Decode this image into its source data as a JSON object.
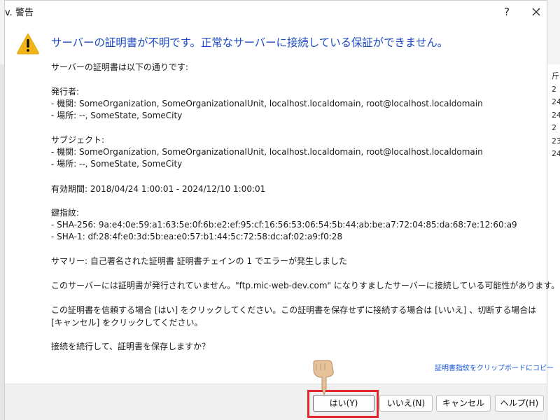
{
  "window": {
    "title": "v. 警告",
    "help_glyph": "?"
  },
  "background": {
    "right_edge_chars": "斤\n2\n24\n24\n2\n23\n24"
  },
  "dialog": {
    "headline": "サーバーの証明書が不明です。正常なサーバーに接続している保証ができません。",
    "lines": {
      "intro": "サーバーの証明書は以下の通りです:",
      "issuer_heading": "発行者:",
      "issuer_org": "- 機関: SomeOrganization, SomeOrganizationalUnit, localhost.localdomain, root@localhost.localdomain",
      "issuer_loc": "- 場所: --, SomeState, SomeCity",
      "subject_heading": "サブジェクト:",
      "subject_org": "- 機関: SomeOrganization, SomeOrganizationalUnit, localhost.localdomain, root@localhost.localdomain",
      "subject_loc": "- 場所: --, SomeState, SomeCity",
      "validity": "有効期間: 2018/04/24 1:00:01 - 2024/12/10 1:00:01",
      "fingerprint_heading": "鍵指紋:",
      "sha256": "- SHA-256: 9a:e4:0e:59:a1:63:5e:0f:6b:e2:ef:95:cf:16:56:53:06:54:5b:44:ab:be:a7:72:04:85:da:68:7e:12:60:a9",
      "sha1": "- SHA-1: df:28:4f:e0:3d:5b:ea:e0:57:b1:44:5c:72:58:dc:af:02:a9:f0:28",
      "summary": "サマリー: 自己署名された証明書 証明書チェインの 1 でエラーが発生しました",
      "warning": "このサーバーには証明書が発行されていません。\"ftp.mic-web-dev.com\" になりすましたサーバーに接続している可能性があります。",
      "instruction": "この証明書を信頼する場合 [はい] をクリックしてください。この証明書を保存せずに接続する場合は [いいえ] 、切断する場合は [キャンセル] をクリックしてください。",
      "question": "接続を続行して、証明書を保存しますか？"
    },
    "copy_link": "証明書指紋をクリップボードにコピー"
  },
  "buttons": {
    "yes": "はい(Y)",
    "no": "いいえ(N)",
    "cancel": "キャンセル",
    "help": "ヘルプ(H)"
  },
  "colors": {
    "headline": "#1e4bc1",
    "link": "#1a58d6",
    "highlight": "#e1262c",
    "warning_icon": "#f2b619"
  }
}
